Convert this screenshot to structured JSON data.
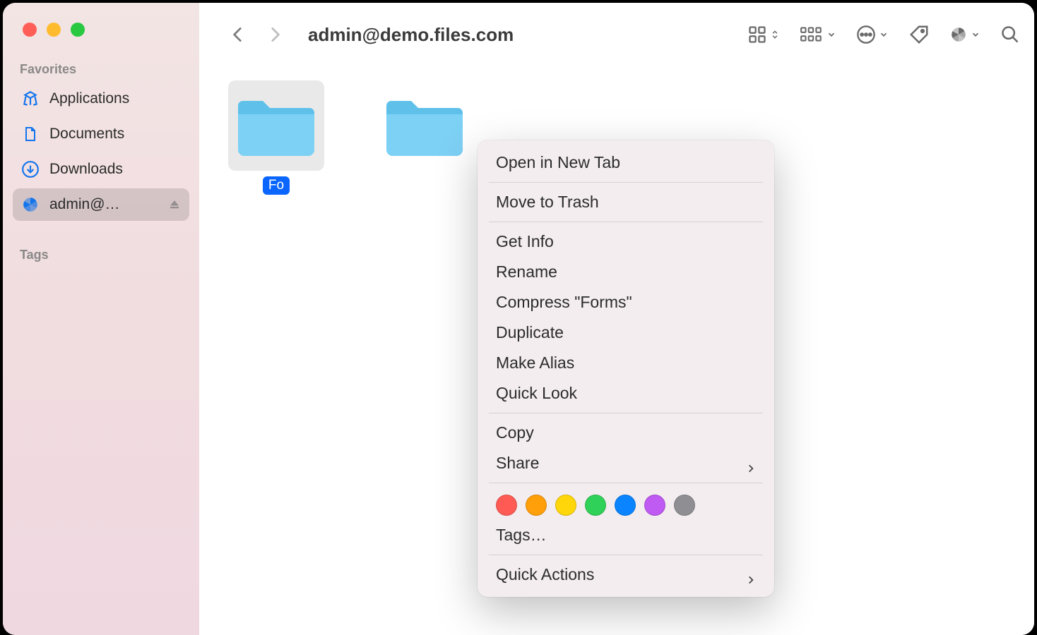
{
  "title": "admin@demo.files.com",
  "sidebar": {
    "sections": {
      "favorites": "Favorites",
      "tags": "Tags"
    },
    "items": [
      {
        "label": "Applications",
        "icon": "apps-icon"
      },
      {
        "label": "Documents",
        "icon": "document-icon"
      },
      {
        "label": "Downloads",
        "icon": "download-icon"
      },
      {
        "label": "admin@…",
        "icon": "pinwheel-icon"
      }
    ]
  },
  "folders": [
    {
      "label": "Fo",
      "selected": true
    },
    {
      "label": "",
      "selected": false
    }
  ],
  "context_menu": {
    "open_new_tab": "Open in New Tab",
    "move_trash": "Move to Trash",
    "get_info": "Get Info",
    "rename": "Rename",
    "compress": "Compress \"Forms\"",
    "duplicate": "Duplicate",
    "make_alias": "Make Alias",
    "quick_look": "Quick Look",
    "copy": "Copy",
    "share": "Share",
    "tags_label": "Tags…",
    "quick_actions": "Quick Actions",
    "tag_colors": [
      "#ff5b54",
      "#ff9f0a",
      "#ffd60a",
      "#30d158",
      "#0a84ff",
      "#bf5af2",
      "#8e8e93"
    ]
  }
}
